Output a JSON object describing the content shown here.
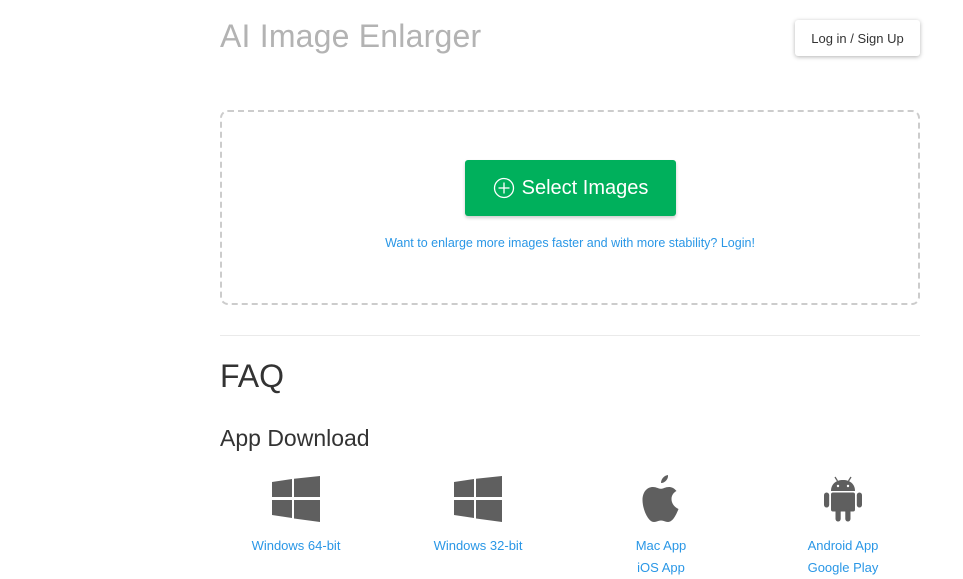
{
  "header": {
    "title": "AI Image Enlarger",
    "login_button": "Log in / Sign Up"
  },
  "upload": {
    "select_button": "Select Images",
    "select_icon": "plus-circle-icon",
    "login_hint": "Want to enlarge more images faster and with more stability? Login!"
  },
  "colors": {
    "primary_green": "#00b05c",
    "link_blue": "#2a97e6",
    "icon_gray": "#5f5f5f"
  },
  "faq": {
    "heading": "FAQ"
  },
  "app_download": {
    "heading": "App Download",
    "apps": [
      {
        "icon": "windows-icon",
        "links": [
          "Windows 64-bit"
        ]
      },
      {
        "icon": "windows-icon",
        "links": [
          "Windows 32-bit"
        ]
      },
      {
        "icon": "apple-icon",
        "links": [
          "Mac App",
          "iOS App"
        ]
      },
      {
        "icon": "android-icon",
        "links": [
          "Android App",
          "Google Play"
        ]
      }
    ]
  }
}
